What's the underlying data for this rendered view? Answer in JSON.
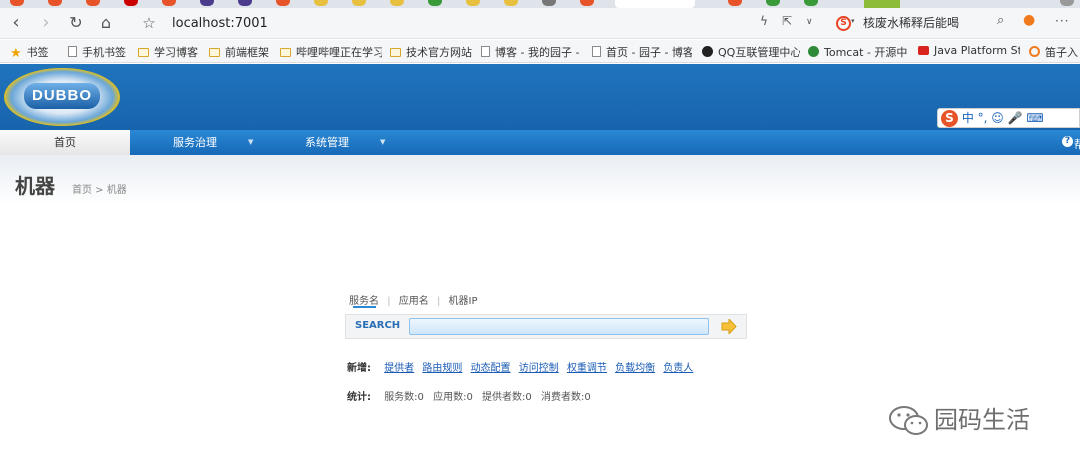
{
  "browser": {
    "url": "localhost:7001",
    "news_text": "核废水稀释后能喝",
    "more_label": "···"
  },
  "bookmarks": [
    {
      "label": "书签",
      "icon": "star-icon"
    },
    {
      "label": "手机书签",
      "icon": "phone-icon"
    },
    {
      "label": "学习博客",
      "icon": "folder-icon"
    },
    {
      "label": "前端框架",
      "icon": "folder-icon"
    },
    {
      "label": "哔哩哔哩正在学习",
      "icon": "folder-icon"
    },
    {
      "label": "技术官方网站",
      "icon": "folder-icon"
    },
    {
      "label": "博客 - 我的园子 -",
      "icon": "page-icon"
    },
    {
      "label": "首页 - 园子 - 博客",
      "icon": "page-icon"
    },
    {
      "label": "QQ互联管理中心",
      "icon": "qq-icon"
    },
    {
      "label": "Tomcat - 开源中国",
      "icon": "tomcat-icon"
    },
    {
      "label": "Java Platform Sta",
      "icon": "java-icon"
    },
    {
      "label": "笛子入",
      "icon": "s-icon"
    }
  ],
  "header": {
    "logo_text": "DUBBO",
    "ime_text": "中 °, ☺ 🎤 ⌨"
  },
  "menu": {
    "items": [
      "首页",
      "服务治理",
      "系统管理"
    ],
    "help_label": "帮"
  },
  "page": {
    "title": "机器",
    "breadcrumb": "首页 > 机器"
  },
  "search": {
    "tabs": [
      "服务名",
      "应用名",
      "机器IP"
    ],
    "label": "SEARCH",
    "value": ""
  },
  "add_row": {
    "label": "新增:",
    "links": [
      "提供者",
      "路由规则",
      "动态配置",
      "访问控制",
      "权重调节",
      "负载均衡",
      "负责人"
    ]
  },
  "stats_row": {
    "label": "统计:",
    "items": [
      "服务数:0",
      "应用数:0",
      "提供者数:0",
      "消费者数:0"
    ]
  },
  "watermark": "园码生活",
  "colors": {
    "header_blue": "#1864ac",
    "menu_blue": "#1769b7",
    "link_blue": "#1a5bb5"
  }
}
